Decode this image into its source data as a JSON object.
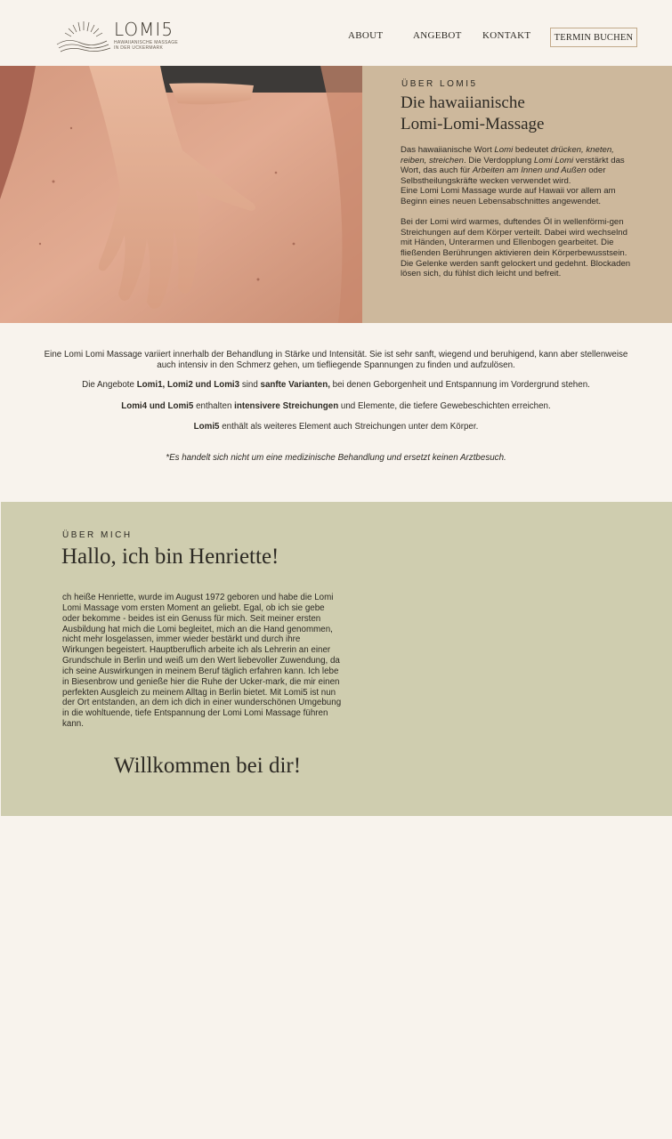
{
  "header": {
    "logo_word": "LOMI5",
    "logo_sub_1": "Hawaiianische Massage",
    "logo_sub_2": "in der Uckermark",
    "nav": {
      "about": "ABOUT",
      "angebot": "ANGEBOT",
      "kontakt": "KONTAKT"
    },
    "cta": "TERMIN BUCHEN"
  },
  "hero": {
    "image_icon": "massage-photo",
    "eyebrow": "ÜBER LOMI5",
    "title_line1": "Die hawaiianische",
    "title_line2": "Lomi-Lomi-Massage",
    "p1_a": "Das hawaiianische Wort ",
    "p1_b": "Lomi",
    "p1_c": " bedeutet ",
    "p1_d": "drücken, kneten, reiben, streichen",
    "p1_e": ". Die Verdopplung ",
    "p1_f": "Lomi Lomi",
    "p1_g": " verstärkt das Wort, das auch für ",
    "p1_h": "Arbeiten am Innen und Außen",
    "p1_i": " oder Selbstheilungskräfte wecken verwendet wird.",
    "p2": "Eine Lomi Lomi Massage wurde auf Hawaii vor allem am Beginn eines neuen Lebensabschnittes angewendet.",
    "p3": "Bei der Lomi wird warmes, duftendes Öl in wellenförmi-gen Streichungen auf dem Körper verteilt. Dabei wird wechselnd mit Händen, Unterarmen und Ellenbogen gearbeitet. Die fließenden Berührungen aktivieren dein Körperbewusstsein. Die Gelenke werden sanft gelockert und gedehnt. Blockaden lösen sich, du fühlst dich leicht und befreit."
  },
  "intro": {
    "p1": "Eine Lomi Lomi Massage variiert innerhalb der Behandlung in Stärke und Intensität. Sie ist sehr sanft, wiegend und beruhigend, kann aber stellenweise auch intensiv in den Schmerz gehen, um tiefliegende Spannungen zu finden und aufzulösen.",
    "p2_a": "Die Angebote ",
    "p2_b": "Lomi1, Lomi2 und Lomi3",
    "p2_c": " sind ",
    "p2_d": "sanfte Varianten,",
    "p2_e": " bei denen Geborgenheit und Entspannung im Vordergrund stehen.",
    "p3_a": "Lomi4 und Lomi5",
    "p3_b": " enthalten ",
    "p3_c": "intensivere Streichungen",
    "p3_d": " und Elemente, die tiefere Gewebeschichten erreichen.",
    "p4_a": "Lomi5",
    "p4_b": " enthält als weiteres Element auch Streichungen unter dem Körper.",
    "disclaimer": "*Es handelt sich nicht um eine medizinische Behandlung und ersetzt keinen Arztbesuch."
  },
  "about": {
    "eyebrow": "ÜBER MICH",
    "title": "Hallo, ich bin Henriette!",
    "text": "ch heiße Henriette, wurde im August 1972 geboren und habe die Lomi Lomi Massage vom ersten Moment an geliebt. Egal, ob ich sie gebe oder bekomme - beides ist ein Genuss für mich. Seit meiner ersten Ausbildung hat mich die Lomi begleitet, mich an die Hand genommen, nicht mehr losgelassen, immer wieder bestärkt und durch ihre Wirkungen begeistert. Hauptberuflich arbeite ich als Lehrerin an einer Grundschule in Berlin und weiß um den Wert liebevoller Zuwendung, da ich seine Auswirkungen in meinem Beruf täglich erfahren kann. Ich lebe in Biesenbrow und genieße hier die Ruhe der Ucker-mark, die mir einen perfekten Ausgleich zu meinem Alltag in Berlin bietet. Mit Lomi5 ist nun der Ort entstanden, an dem ich dich in einer wunderschönen Umgebung in die wohltuende, tiefe Entspannung der Lomi Lomi Massage führen kann.",
    "welcome": "Willkommen bei dir!"
  },
  "colors": {
    "background": "#f8f3ed",
    "hero_panel": "#cdb89c",
    "about_bg": "#cfcdaf",
    "cta_border": "#c2a98a"
  }
}
